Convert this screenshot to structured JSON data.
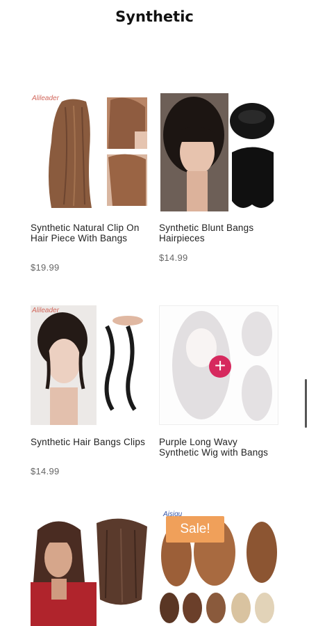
{
  "header": {
    "title": "Synthetic"
  },
  "products": [
    {
      "name": "Synthetic Natural Clip On Hair Piece With Bangs",
      "price": "$19.99",
      "image": "clip-on-hair-piece-photo",
      "brand_text": "Alileader"
    },
    {
      "name": "Synthetic Blunt Bangs Hairpieces",
      "price": "$14.99",
      "image": "blunt-bangs-photo"
    },
    {
      "name": "Synthetic Hair Bangs Clips",
      "price": "$14.99",
      "image": "hair-bangs-clips-photo",
      "brand_text": "Alileader"
    },
    {
      "name": "Purple Long Wavy Synthetic Wig with Bangs",
      "price": "",
      "image": "wavy-wig-placeholder",
      "add_icon": "plus-icon"
    },
    {
      "name": "",
      "price": "",
      "image": "bob-wig-photo"
    },
    {
      "name": "",
      "price": "",
      "image": "curly-wigs-photo",
      "badge": "Sale!",
      "brand_text": "Aisiqu"
    }
  ],
  "colors": {
    "sale_badge": "#f0a05a",
    "add_button": "#d6295e",
    "price": "#666666"
  }
}
